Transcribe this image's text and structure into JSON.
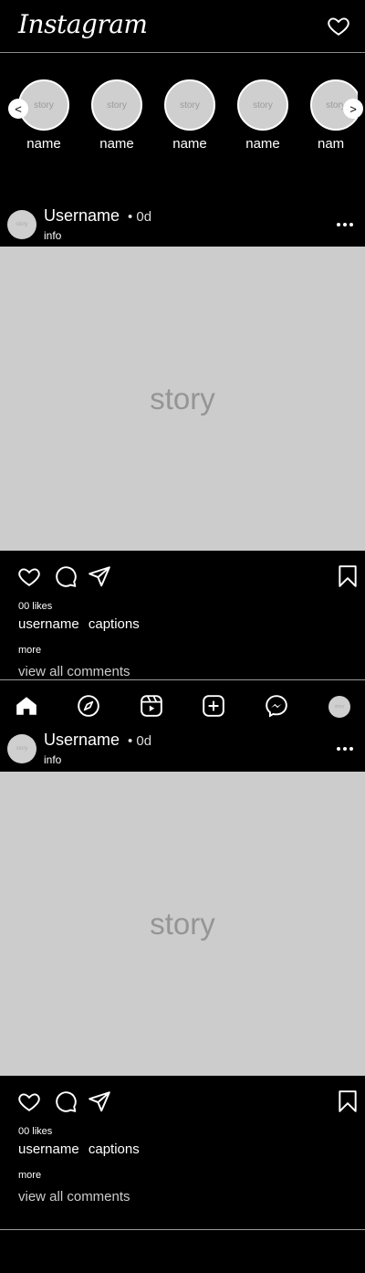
{
  "header": {
    "logo": "Instagram",
    "heart_icon": "heart-icon"
  },
  "stories": {
    "prev_label": "<",
    "next_label": ">",
    "items": [
      {
        "placeholder": "story",
        "name": "name"
      },
      {
        "placeholder": "story",
        "name": "name"
      },
      {
        "placeholder": "story",
        "name": "name"
      },
      {
        "placeholder": "story",
        "name": "name"
      },
      {
        "placeholder": "story",
        "name": "nam"
      }
    ]
  },
  "posts": [
    {
      "avatar_text": "story",
      "username": "Username",
      "time": "• 0d",
      "info": "info",
      "image_text": "story",
      "likes": "00 likes",
      "caption_user": "username",
      "caption_text": "captions",
      "more": "more",
      "view_comments": "view all comments"
    },
    {
      "avatar_text": "story",
      "username": "Username",
      "time": "• 0d",
      "info": "info",
      "image_text": "story",
      "likes": "00 likes",
      "caption_user": "username",
      "caption_text": "captions",
      "more": "more",
      "view_comments": "view all comments"
    }
  ],
  "bottom_nav": {
    "avatar_text": "story",
    "icons": [
      "home-icon",
      "explore-icon",
      "reels-icon",
      "add-icon",
      "messenger-icon"
    ]
  },
  "colors": {
    "background": "#000000",
    "placeholder": "#cccccc",
    "text": "#ffffff"
  }
}
